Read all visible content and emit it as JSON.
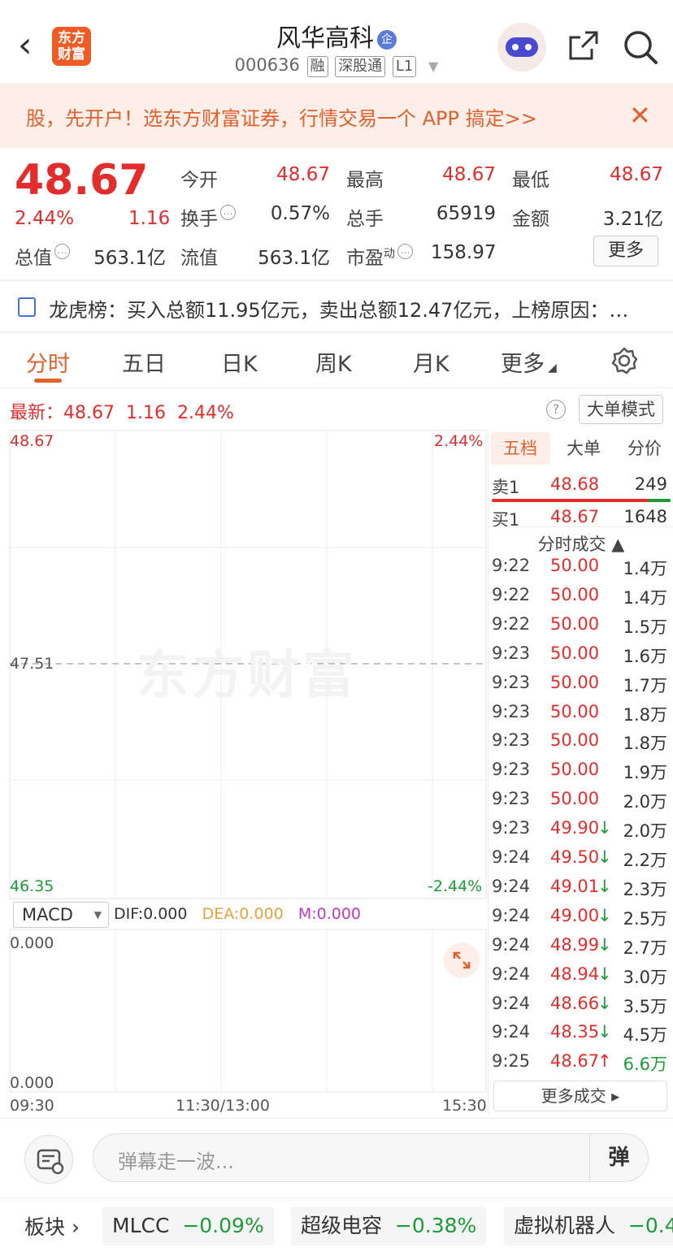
{
  "header": {
    "logo_text": "东方财富",
    "title": "风华高科",
    "title_badge": "企",
    "code": "000636",
    "tags": [
      "融",
      "深股通",
      "L1"
    ]
  },
  "promo": {
    "text": "股，先开户！选东方财富证券，行情交易一个 APP 搞定>>"
  },
  "quote": {
    "price": "48.67",
    "change_pct": "2.44%",
    "change_abs": "1.16",
    "fields": [
      {
        "label": "今开",
        "value": "48.67",
        "color": "red"
      },
      {
        "label": "最高",
        "value": "48.67",
        "color": "red"
      },
      {
        "label": "最低",
        "value": "48.67",
        "color": "red"
      },
      {
        "label": "换手",
        "value": "0.57%",
        "color": "normal"
      },
      {
        "label": "总手",
        "value": "65919",
        "color": "normal"
      },
      {
        "label": "金额",
        "value": "3.21亿",
        "color": "normal"
      },
      {
        "label": "总值",
        "value": "563.1亿",
        "color": "normal"
      },
      {
        "label": "流值",
        "value": "563.1亿",
        "color": "normal"
      },
      {
        "label": "市盈",
        "value": "158.97",
        "color": "normal"
      }
    ],
    "pe_sup": "动",
    "more_label": "更多"
  },
  "dragon": {
    "text": "龙虎榜：买入总额11.95亿元，卖出总额12.47亿元，上榜原因：…"
  },
  "tabs": [
    "分时",
    "五日",
    "日K",
    "周K",
    "月K",
    "更多"
  ],
  "latest": {
    "label": "最新：",
    "price": "48.67",
    "change": "1.16",
    "pct": "2.44%"
  },
  "help_label": "?",
  "big_order_label": "大单模式",
  "chart": {
    "y_top": "48.67",
    "y_mid": "47.51",
    "y_bottom": "46.35",
    "pct_top": "2.44%",
    "pct_bottom": "-2.44%",
    "watermark": "东方财富",
    "macd_top": "0.000",
    "macd_bottom": "0.000",
    "x_start": "09:30",
    "x_mid": "11:30/13:00",
    "x_end": "15:30"
  },
  "macd": {
    "selector": "MACD",
    "dif": "DIF:0.000",
    "dea": "DEA:0.000",
    "m": "M:0.000",
    "colors": {
      "dif": "#333333",
      "dea": "#e6a23c",
      "m": "#c03ac0"
    }
  },
  "side": {
    "tabs": [
      "五档",
      "大单",
      "分价"
    ],
    "sell1": {
      "label": "卖1",
      "price": "48.68",
      "vol": "249"
    },
    "buy1": {
      "label": "买1",
      "price": "48.67",
      "vol": "1648"
    },
    "ticks_title": "分时成交 ▲",
    "ticks": [
      {
        "time": "9:22",
        "price": "50.00",
        "arrow": "",
        "vol": "1.4万",
        "dir": "flat"
      },
      {
        "time": "9:22",
        "price": "50.00",
        "arrow": "",
        "vol": "1.4万",
        "dir": "flat"
      },
      {
        "time": "9:22",
        "price": "50.00",
        "arrow": "",
        "vol": "1.5万",
        "dir": "flat"
      },
      {
        "time": "9:23",
        "price": "50.00",
        "arrow": "",
        "vol": "1.6万",
        "dir": "flat"
      },
      {
        "time": "9:23",
        "price": "50.00",
        "arrow": "",
        "vol": "1.7万",
        "dir": "flat"
      },
      {
        "time": "9:23",
        "price": "50.00",
        "arrow": "",
        "vol": "1.8万",
        "dir": "flat"
      },
      {
        "time": "9:23",
        "price": "50.00",
        "arrow": "",
        "vol": "1.8万",
        "dir": "flat"
      },
      {
        "time": "9:23",
        "price": "50.00",
        "arrow": "",
        "vol": "1.9万",
        "dir": "flat"
      },
      {
        "time": "9:23",
        "price": "50.00",
        "arrow": "",
        "vol": "2.0万",
        "dir": "flat"
      },
      {
        "time": "9:23",
        "price": "49.90",
        "arrow": "↓",
        "vol": "2.0万",
        "dir": "down"
      },
      {
        "time": "9:24",
        "price": "49.50",
        "arrow": "↓",
        "vol": "2.2万",
        "dir": "down"
      },
      {
        "time": "9:24",
        "price": "49.01",
        "arrow": "↓",
        "vol": "2.3万",
        "dir": "down"
      },
      {
        "time": "9:24",
        "price": "49.00",
        "arrow": "↓",
        "vol": "2.5万",
        "dir": "down"
      },
      {
        "time": "9:24",
        "price": "48.99",
        "arrow": "↓",
        "vol": "2.7万",
        "dir": "down"
      },
      {
        "time": "9:24",
        "price": "48.94",
        "arrow": "↓",
        "vol": "3.0万",
        "dir": "down"
      },
      {
        "time": "9:24",
        "price": "48.66",
        "arrow": "↓",
        "vol": "3.5万",
        "dir": "down"
      },
      {
        "time": "9:24",
        "price": "48.35",
        "arrow": "↓",
        "vol": "4.5万",
        "dir": "down"
      },
      {
        "time": "9:25",
        "price": "48.67",
        "arrow": "↑",
        "vol": "6.6万",
        "dir": "up"
      }
    ],
    "more_trades": "更多成交 ▸"
  },
  "bottom": {
    "placeholder": "弹幕走一波...",
    "dan_label": "弹"
  },
  "sectors": {
    "label": "板块 ›",
    "items": [
      {
        "name": "MLCC",
        "pct": "−0.09%"
      },
      {
        "name": "超级电容",
        "pct": "−0.38%"
      },
      {
        "name": "虚拟机器人",
        "pct": "−0.4"
      }
    ]
  },
  "colors": {
    "up": "#e32d2d",
    "down": "#1c9b3a",
    "accent": "#e0612f"
  }
}
